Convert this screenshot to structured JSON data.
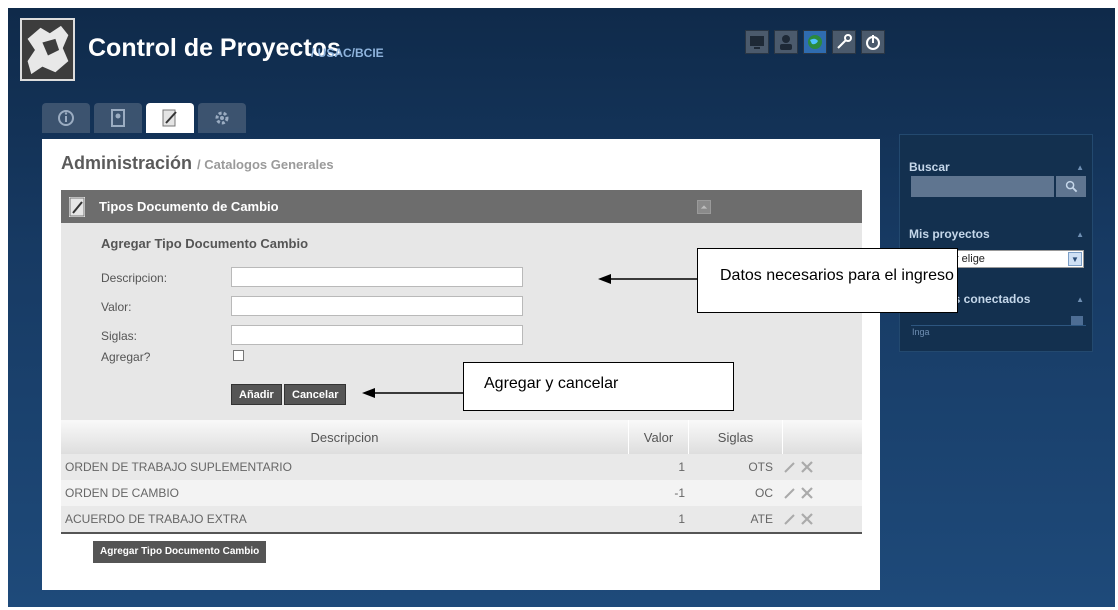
{
  "header": {
    "title": "Control de Proyectos",
    "subtitle": "/ USAC/BCIE",
    "icons": [
      "monitor-icon",
      "user-icon",
      "globe-icon",
      "wrench-icon",
      "power-icon"
    ]
  },
  "tabs": [
    "info-icon",
    "badge-icon",
    "edit-icon",
    "settings-icon"
  ],
  "page": {
    "title": "Administración",
    "crumb": "/ Catalogos Generales"
  },
  "panel": {
    "title": "Tipos Documento de Cambio",
    "form": {
      "title": "Agregar Tipo Documento Cambio",
      "label_descripcion": "Descripcion:",
      "label_valor": "Valor:",
      "label_siglas": "Siglas:",
      "label_agregar": "Agregar?",
      "value_descripcion": "",
      "value_valor": "",
      "value_siglas": "",
      "btn_add": "Añadir",
      "btn_cancel": "Cancelar"
    },
    "table": {
      "headers": [
        "Descripcion",
        "Valor",
        "Siglas"
      ],
      "rows": [
        {
          "descripcion": "ORDEN DE TRABAJO SUPLEMENTARIO",
          "valor": "1",
          "siglas": "OTS"
        },
        {
          "descripcion": "ORDEN DE CAMBIO",
          "valor": "-1",
          "siglas": "OC"
        },
        {
          "descripcion": "ACUERDO DE TRABAJO EXTRA",
          "valor": "1",
          "siglas": "ATE"
        }
      ]
    },
    "add_button": "Agregar Tipo Documento Cambio"
  },
  "sidebar": {
    "search_title": "Buscar",
    "search_value": "",
    "projects_title": "Mis proyectos",
    "projects_select": "Por favor elige",
    "online_title": "Usuarios conectados",
    "online_user": "Inga"
  },
  "callouts": {
    "datos": "Datos necesarios para el ingreso",
    "agregar": "Agregar y cancelar"
  },
  "colors": {
    "header_bg": "#0f2a4a",
    "panel_header": "#6d6d6d",
    "button": "#555555"
  }
}
